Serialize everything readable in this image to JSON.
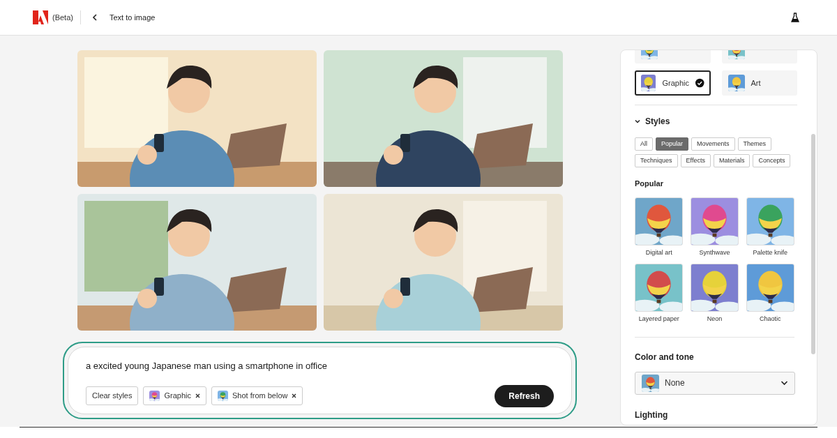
{
  "header": {
    "beta_label": "(Beta)",
    "title": "Text to image"
  },
  "prompt": {
    "value": "a excited young Japanese man using a smartphone in office",
    "tags": [
      {
        "kind": "clear",
        "label": "Clear styles"
      },
      {
        "kind": "style",
        "label": "Graphic"
      },
      {
        "kind": "style",
        "label": "Shot from below"
      }
    ],
    "button": "Refresh"
  },
  "panel": {
    "content_types": [
      {
        "selected": false
      },
      {
        "selected": false
      },
      {
        "label": "Graphic",
        "selected": true
      },
      {
        "label": "Art",
        "selected": false
      }
    ],
    "styles": {
      "title": "Styles",
      "expanded": true,
      "filters": [
        {
          "label": "All",
          "selected": false
        },
        {
          "label": "Popular",
          "selected": true
        },
        {
          "label": "Movements",
          "selected": false
        },
        {
          "label": "Themes",
          "selected": false
        },
        {
          "label": "Techniques",
          "selected": false
        },
        {
          "label": "Effects",
          "selected": false
        },
        {
          "label": "Materials",
          "selected": false
        },
        {
          "label": "Concepts",
          "selected": false
        }
      ],
      "section_title": "Popular",
      "items": [
        {
          "label": "Digital art"
        },
        {
          "label": "Synthwave"
        },
        {
          "label": "Palette knife"
        },
        {
          "label": "Layered paper"
        },
        {
          "label": "Neon"
        },
        {
          "label": "Chaotic"
        }
      ]
    },
    "color_and_tone": {
      "title": "Color and tone",
      "value": "None"
    },
    "lighting": {
      "title": "Lighting"
    }
  }
}
